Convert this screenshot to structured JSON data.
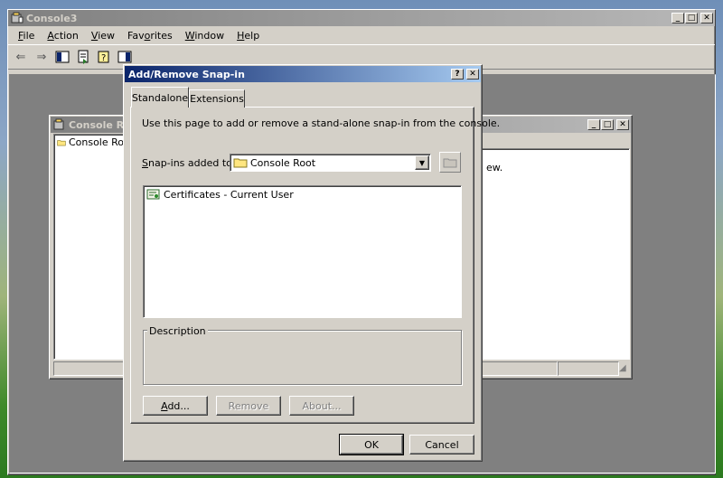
{
  "main_window": {
    "title": "Console3",
    "menu": [
      "File",
      "Action",
      "View",
      "Favorites",
      "Window",
      "Help"
    ]
  },
  "child_window": {
    "title": "Console Ro",
    "tree_item": "Console Ro",
    "right_text": "ew."
  },
  "dialog": {
    "title": "Add/Remove Snap-in",
    "tabs": [
      "Standalone",
      "Extensions"
    ],
    "intro": "Use this page to add or remove a stand-alone snap-in from the console.",
    "snapins_label": "Snap-ins added to:",
    "snapins_selected": "Console Root",
    "list_items": [
      "Certificates - Current User"
    ],
    "description_label": "Description",
    "add_label": "Add...",
    "remove_label": "Remove",
    "about_label": "About...",
    "ok_label": "OK",
    "cancel_label": "Cancel"
  }
}
